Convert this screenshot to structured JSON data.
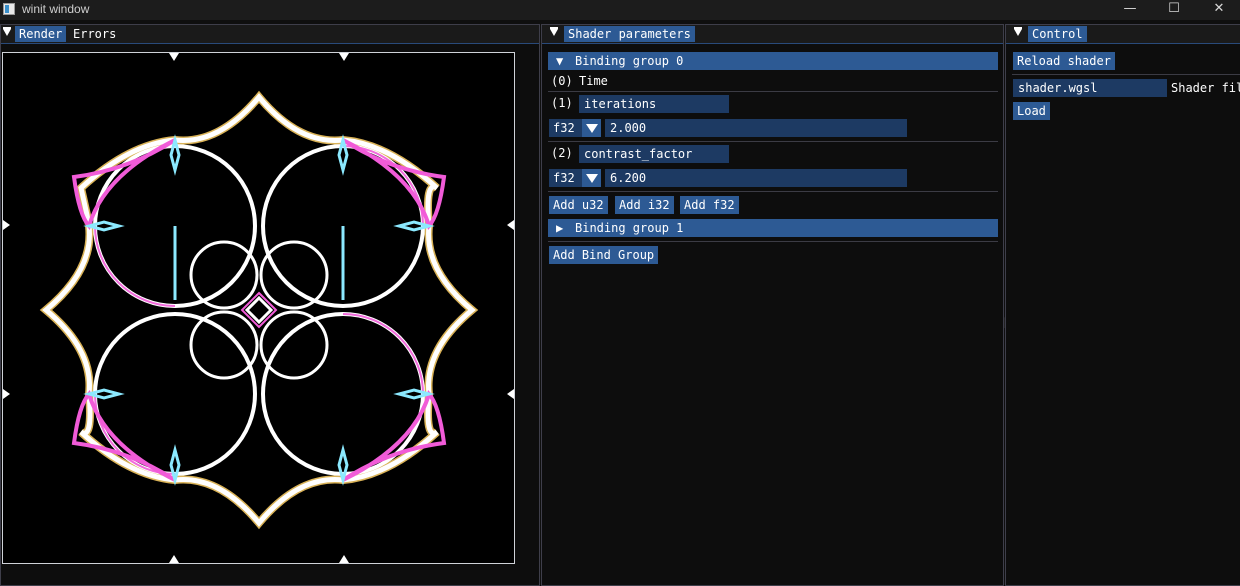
{
  "window": {
    "title": "winit window",
    "minimize_glyph": "—",
    "maximize_glyph": "☐",
    "close_glyph": "✕"
  },
  "render_panel": {
    "tabs": [
      "Render",
      "Errors"
    ],
    "active_tab": "Render"
  },
  "shader_panel": {
    "tab": "Shader parameters",
    "group0": {
      "title": "Binding group 0",
      "expanded": true,
      "arrow": "▼",
      "params": [
        {
          "index": "(0)",
          "label": "Time"
        },
        {
          "index": "(1)",
          "name": "iterations",
          "type": "f32",
          "value": "2.000"
        },
        {
          "index": "(2)",
          "name": "contrast_factor",
          "type": "f32",
          "value": "6.200"
        }
      ],
      "add_buttons": [
        "Add u32",
        "Add i32",
        "Add f32"
      ]
    },
    "group1": {
      "title": "Binding group 1",
      "expanded": false,
      "arrow": "▶"
    },
    "add_bind_group": "Add Bind Group"
  },
  "control_panel": {
    "tab": "Control",
    "reload_button": "Reload shader",
    "shader_file_value": "shader.wgsl",
    "shader_file_label": "Shader fil",
    "load_button": "Load"
  },
  "colors": {
    "accent": "#2d5a94",
    "input_bg": "#1d3a63",
    "window_bg": "#0f0f0f",
    "render_bg": "#000000"
  },
  "icons": {
    "app": "app-window-icon",
    "collapse": "collapse-triangle-icon",
    "render": "kaleidoscope-shader-output"
  }
}
